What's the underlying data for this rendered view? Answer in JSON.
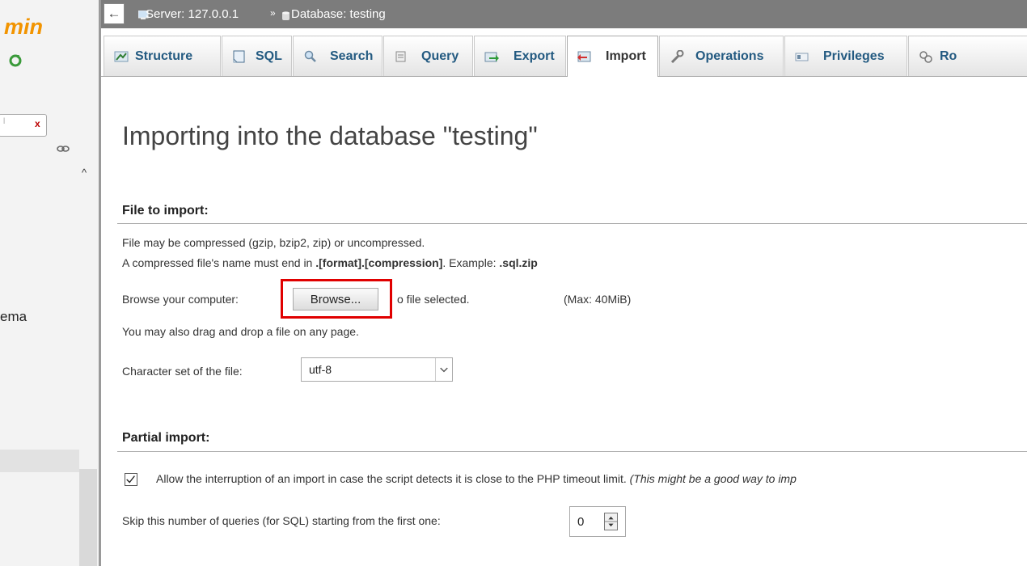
{
  "nav": {
    "logo_text": "min",
    "filter_clear": "x",
    "db_label": "ema",
    "scroll_up": "^"
  },
  "breadcrumb": {
    "collapse_glyph": "←",
    "server": "Server: 127.0.0.1",
    "separator": "»",
    "database": "Database: testing"
  },
  "tabs": [
    {
      "label": "Structure",
      "icon": "structure-icon",
      "active": false
    },
    {
      "label": "SQL",
      "icon": "sql-icon",
      "active": false
    },
    {
      "label": "Search",
      "icon": "search-icon",
      "active": false
    },
    {
      "label": "Query",
      "icon": "query-icon",
      "active": false
    },
    {
      "label": "Export",
      "icon": "export-icon",
      "active": false
    },
    {
      "label": "Import",
      "icon": "import-icon",
      "active": true
    },
    {
      "label": "Operations",
      "icon": "wrench-icon",
      "active": false
    },
    {
      "label": "Privileges",
      "icon": "privileges-icon",
      "active": false
    },
    {
      "label": "Ro",
      "icon": "routines-icon",
      "active": false
    }
  ],
  "main": {
    "title": "Importing into the database \"testing\"",
    "file_section": {
      "title": "File to import:",
      "line1": "File may be compressed (gzip, bzip2, zip) or uncompressed.",
      "line2_prefix": "A compressed file's name must end in ",
      "line2_format": ".[format].[compression]",
      "line2_mid": ". Example: ",
      "line2_example": ".sql.zip",
      "browse_label": "Browse your computer:",
      "browse_button": "Browse...",
      "no_file": "o file selected.",
      "max_size": "(Max: 40MiB)",
      "drag_drop": "You may also drag and drop a file on any page.",
      "charset_label": "Character set of the file:",
      "charset_value": "utf-8"
    },
    "partial_section": {
      "title": "Partial import:",
      "interrupt_text": "Allow the interruption of an import in case the script detects it is close to the PHP timeout limit.",
      "interrupt_hint": "(This might be a good way to imp",
      "interrupt_checked": true,
      "skip_label": "Skip this number of queries (for SQL) starting from the first one:",
      "skip_value": "0"
    }
  },
  "colors": {
    "brand_orange": "#f29400",
    "tab_link": "#235a81",
    "breadcrumb_bg": "#7c7c7c",
    "highlight_red": "#e00000"
  }
}
